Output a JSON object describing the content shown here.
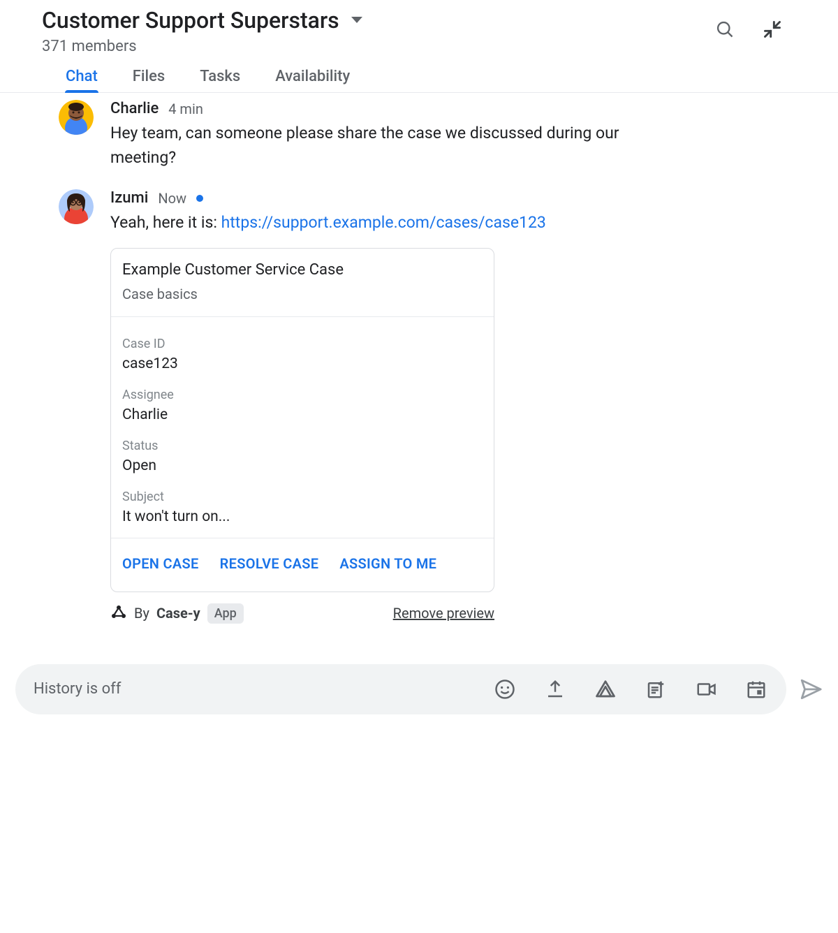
{
  "header": {
    "room_title": "Customer Support Superstars",
    "member_count": "371 members"
  },
  "tabs": {
    "items": [
      "Chat",
      "Files",
      "Tasks",
      "Availability"
    ],
    "active_index": 0
  },
  "messages": [
    {
      "author": "Charlie",
      "time": "4 min",
      "text": "Hey team, can someone please share the case we discussed during our meeting?"
    },
    {
      "author": "Izumi",
      "time": "Now",
      "unread": true,
      "text_prefix": "Yeah, here it is: ",
      "link": "https://support.example.com/cases/case123",
      "card": {
        "title": "Example Customer Service Case",
        "subtitle": "Case basics",
        "fields": [
          {
            "label": "Case ID",
            "value": "case123"
          },
          {
            "label": "Assignee",
            "value": "Charlie"
          },
          {
            "label": "Status",
            "value": "Open"
          },
          {
            "label": "Subject",
            "value": "It won't turn on..."
          }
        ],
        "actions": [
          "OPEN CASE",
          "RESOLVE CASE",
          "ASSIGN TO ME"
        ],
        "by_prefix": "By ",
        "by_app": "Case-y",
        "app_chip": "App",
        "remove_label": "Remove preview"
      }
    }
  ],
  "composer": {
    "placeholder": "History is off"
  },
  "colors": {
    "accent": "#1a73e8",
    "text_secondary": "#5f6368",
    "border": "#dadce0"
  }
}
